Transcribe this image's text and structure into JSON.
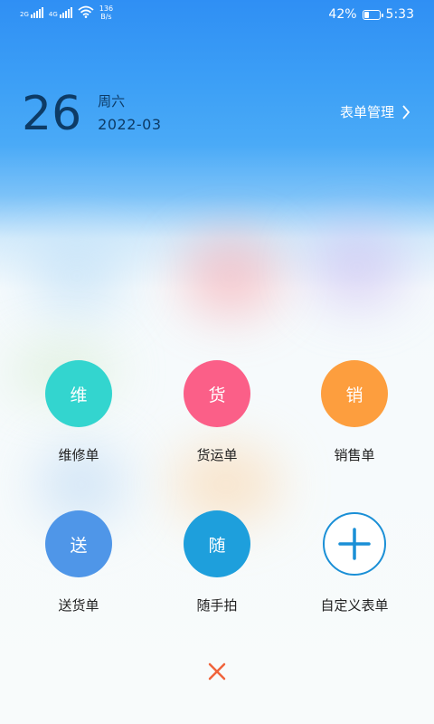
{
  "status_bar": {
    "signal1_label": "2G",
    "signal2_label": "4G",
    "net_speed_value": "136",
    "net_speed_unit": "B/s",
    "battery_percent": "42%",
    "battery_level": 0.42,
    "time": "5:33"
  },
  "header": {
    "day": "26",
    "weekday": "周六",
    "year_month": "2022-03",
    "form_management": "表单管理"
  },
  "forms": [
    {
      "glyph": "维",
      "label": "维修单",
      "color": "#33d5cf"
    },
    {
      "glyph": "货",
      "label": "货运单",
      "color": "#fb5f88"
    },
    {
      "glyph": "销",
      "label": "销售单",
      "color": "#fd9e3e"
    },
    {
      "glyph": "送",
      "label": "送货单",
      "color": "#4f96e8"
    },
    {
      "glyph": "随",
      "label": "随手拍",
      "color": "#1e9fdc"
    },
    {
      "glyph": "",
      "label": "自定义表单",
      "color": "#1a8fd6"
    }
  ],
  "icons": {
    "wifi": "wifi-icon",
    "battery": "battery-icon",
    "chevron": "chevron-right-icon",
    "add": "plus-icon",
    "close": "close-icon"
  },
  "colors": {
    "accent": "#1a8fd6",
    "close": "#f0643c",
    "day_text": "#0d3b66"
  }
}
